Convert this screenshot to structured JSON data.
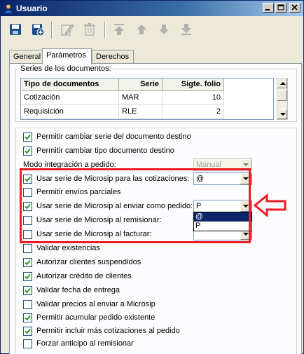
{
  "window": {
    "title": "Usuario",
    "icon": "user-icon",
    "controls": [
      "minimize-icon",
      "maximize-icon",
      "close-icon"
    ]
  },
  "toolbar": {
    "buttons": [
      {
        "name": "save",
        "icon": "save-icon",
        "enabled": true
      },
      {
        "name": "save-new",
        "icon": "save-new-icon",
        "enabled": true
      },
      {
        "name": "edit",
        "icon": "edit-icon",
        "enabled": false
      },
      {
        "name": "delete",
        "icon": "trash-icon",
        "enabled": false
      },
      {
        "name": "first",
        "icon": "first-record-icon",
        "enabled": false
      },
      {
        "name": "previous",
        "icon": "previous-record-icon",
        "enabled": false
      },
      {
        "name": "next",
        "icon": "next-record-icon",
        "enabled": false
      },
      {
        "name": "last",
        "icon": "last-record-icon",
        "enabled": false
      }
    ]
  },
  "tabs": {
    "general": "General",
    "parametros": "Parámetros",
    "derechos": "Derechos",
    "active": "Parámetros"
  },
  "series": {
    "group_label": "Series de los documentos:",
    "columns": [
      "Tipo de documentos",
      "Serie",
      "Sigte. folio"
    ],
    "rows": [
      [
        "Cotización",
        "MAR",
        "10"
      ],
      [
        "Requisición",
        "RLE",
        "2"
      ]
    ]
  },
  "options": {
    "cambiar_serie": {
      "label": "Permitir cambiar serie del documento destino",
      "checked": true
    },
    "cambiar_tipo": {
      "label": "Permitir cambiar tipo documento destino",
      "checked": true
    },
    "modo_integracion": {
      "label": "Modo integración a pedido:",
      "value": "Manual",
      "enabled": false
    },
    "serie_cotizaciones": {
      "label": "Usar serie de Microsip para las cotizaciones:",
      "checked": true,
      "value": "@"
    },
    "envios_parciales": {
      "label": "Permitir envíos parciales",
      "checked": false
    },
    "serie_pedido": {
      "label": "Usar serie de Microsip al enviar como pedido:",
      "checked": true,
      "value": "P",
      "dropdown_options": [
        "@",
        "P"
      ],
      "highlighted_option": "@"
    },
    "serie_remisionar": {
      "label": "Usar serie de Microsip al remisionar:",
      "checked": false
    },
    "serie_facturar": {
      "label": "Usar serie de Microsip al facturar:",
      "checked": false,
      "value": ""
    },
    "validar_existencias": {
      "label": "Validar existencias",
      "checked": false
    },
    "autorizar_suspendidos": {
      "label": "Autorizar clientes suspendidos",
      "checked": true
    },
    "autorizar_credito": {
      "label": "Autorizar crédito de clientes",
      "checked": true
    },
    "validar_fecha": {
      "label": "Validar fecha de entrega",
      "checked": true
    },
    "validar_precios": {
      "label": "Validar precios al enviar a Microsip",
      "checked": false
    },
    "acumular_pedido": {
      "label": "Permitir acumular pedido existente",
      "checked": true
    },
    "incluir_cotizaciones": {
      "label": "Permitir incluir más cotizaciones al pedido",
      "checked": true
    },
    "forzar_anticipo": {
      "label": "Forzar anticipo al remisionar",
      "checked": false
    }
  },
  "annotation": {
    "highlight_color": "#ee1c25",
    "arrow_icon": "left-arrow-icon"
  },
  "colors": {
    "titlebar": "#0a246a",
    "selection": "#0a246a",
    "panel": "#fcfcfe",
    "face": "#ece9d8"
  }
}
